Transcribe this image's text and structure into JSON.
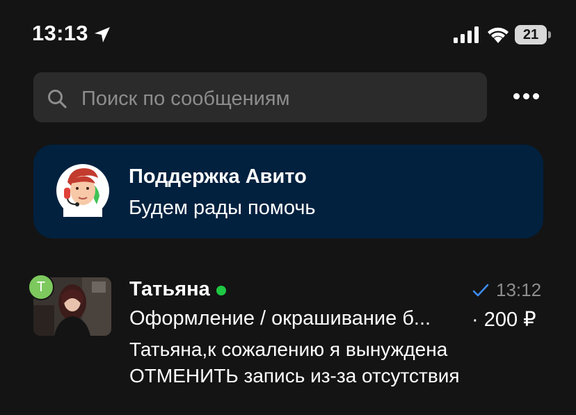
{
  "status_bar": {
    "time": "13:13",
    "battery_text": "21",
    "battery_level": 0.21
  },
  "search": {
    "placeholder": "Поиск по сообщениям"
  },
  "support": {
    "title": "Поддержка Авито",
    "subtitle": "Будем рады помочь"
  },
  "chats": [
    {
      "name": "Татьяна",
      "avatar_letter": "Т",
      "online": true,
      "read": true,
      "time": "13:12",
      "ad_title": "Оформление / окрашивание б...",
      "price": "· 200 ₽",
      "message": "Татьяна,к сожалению я вынуждена ОТМЕНИТЬ запись из-за отсутствия"
    }
  ],
  "colors": {
    "background": "#141414",
    "support_card": "#01213f",
    "online": "#1fc843",
    "read_check": "#3d8cf5",
    "avatar_letter_bg": "#7dc95e"
  }
}
